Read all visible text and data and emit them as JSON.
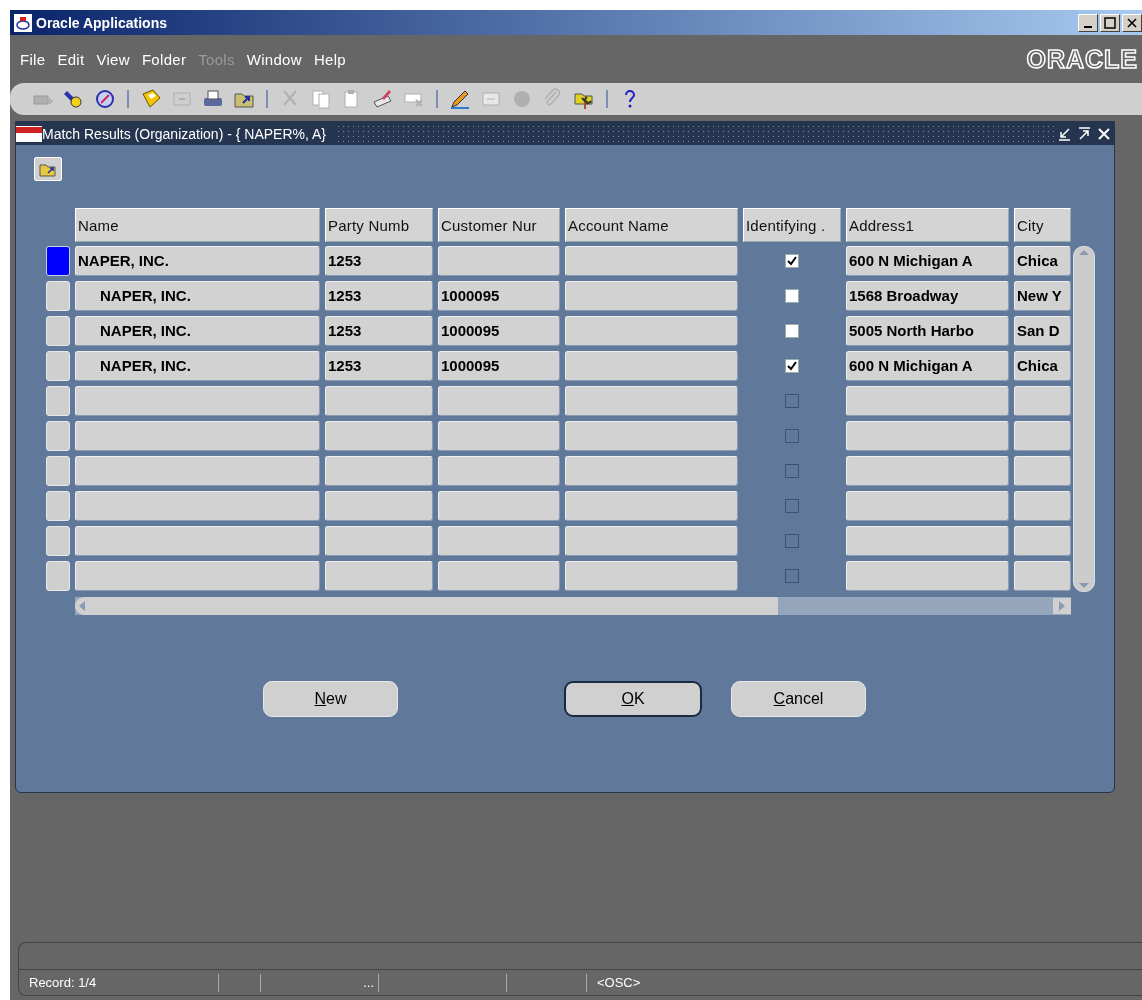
{
  "window": {
    "title": "Oracle Applications"
  },
  "menu": [
    {
      "label": "File",
      "disabled": false
    },
    {
      "label": "Edit",
      "disabled": false
    },
    {
      "label": "View",
      "disabled": false
    },
    {
      "label": "Folder",
      "disabled": false
    },
    {
      "label": "Tools",
      "disabled": true
    },
    {
      "label": "Window",
      "disabled": false
    },
    {
      "label": "Help",
      "disabled": false
    }
  ],
  "logo": "ORACLE",
  "toolbar": [
    {
      "kind": "new",
      "disabled": true
    },
    {
      "kind": "find",
      "disabled": false
    },
    {
      "kind": "navigate",
      "disabled": false
    },
    {
      "kind": "separator"
    },
    {
      "kind": "save",
      "disabled": false
    },
    {
      "kind": "next",
      "disabled": true
    },
    {
      "kind": "print",
      "disabled": false
    },
    {
      "kind": "close-form",
      "disabled": false
    },
    {
      "kind": "separator"
    },
    {
      "kind": "cut",
      "disabled": true
    },
    {
      "kind": "copy",
      "disabled": true
    },
    {
      "kind": "paste",
      "disabled": true
    },
    {
      "kind": "clear",
      "disabled": false
    },
    {
      "kind": "delete",
      "disabled": true
    },
    {
      "kind": "separator"
    },
    {
      "kind": "edit",
      "disabled": false
    },
    {
      "kind": "zoom",
      "disabled": true
    },
    {
      "kind": "translate",
      "disabled": true
    },
    {
      "kind": "attach",
      "disabled": true
    },
    {
      "kind": "folder-tools",
      "disabled": false
    },
    {
      "kind": "separator"
    },
    {
      "kind": "help",
      "disabled": false
    }
  ],
  "dialog": {
    "title": "Match Results (Organization) - { NAPER%, A}"
  },
  "table": {
    "columns": [
      "Name",
      "Party Numb",
      "Customer Nur",
      "Account Name",
      "Identifying .",
      "Address1",
      "City"
    ],
    "rows": [
      {
        "kind": "record",
        "selected": true,
        "name": "NAPER, INC.",
        "party_number": "1253",
        "identifying": true,
        "address1": "600 N Michigan A",
        "city": "Chica",
        "children": [
          {
            "kind": "record",
            "selected": false,
            "name": "NAPER, INC.",
            "party_number": "1253",
            "customer_number": "1000095",
            "identifying": false,
            "address1": "1568 Broadway",
            "city": "New Y"
          },
          {
            "kind": "record",
            "selected": false,
            "name": "NAPER, INC.",
            "party_number": "1253",
            "customer_number": "1000095",
            "identifying": false,
            "address1": "5005 North Harbo",
            "city": "San D"
          },
          {
            "kind": "record",
            "selected": false,
            "name": "NAPER, INC.",
            "party_number": "1253",
            "customer_number": "1000095",
            "identifying": true,
            "address1": "600 N Michigan A",
            "city": "Chica"
          }
        ]
      },
      {
        "kind": "blank",
        "selected": false,
        "identifying": false
      },
      {
        "kind": "blank",
        "selected": false,
        "identifying": false
      },
      {
        "kind": "blank",
        "selected": false,
        "identifying": false
      },
      {
        "kind": "blank",
        "selected": false,
        "identifying": false
      },
      {
        "kind": "blank",
        "selected": false,
        "identifying": false
      },
      {
        "kind": "blank",
        "selected": false,
        "identifying": false
      }
    ]
  },
  "buttons": [
    {
      "label": "New",
      "default": false
    },
    {
      "label": "OK",
      "default": true
    },
    {
      "label": "Cancel",
      "default": false
    }
  ],
  "status_bar": {
    "record": "Record: 1/4",
    "ellipsis": "...",
    "mode": "<OSC>"
  }
}
